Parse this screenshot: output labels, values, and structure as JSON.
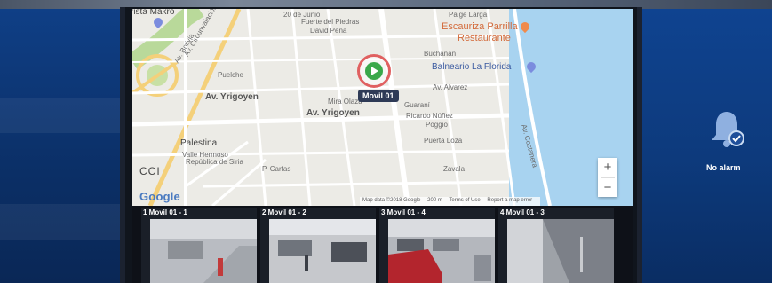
{
  "map": {
    "provider": "Google",
    "attribution": {
      "map_data": "Map data ©2018 Google",
      "scale": "200 m",
      "terms": "Terms of Use",
      "report": "Report a map error"
    },
    "zoom_in": "+",
    "zoom_out": "−",
    "vehicle_label": "Movil 01",
    "pois": {
      "makro": "rista Makro",
      "escaurizza": "Escauriza Parrilla",
      "restaurante": "Restaurante",
      "balneario": "Balneario La Florida"
    },
    "streets": {
      "yrigoyen": "Av. Yrigoyen",
      "yrigoyen2": "Av. Yrigoyen",
      "palestina": "Palestina",
      "ccl": "CCI",
      "buchanan": "Buchanan",
      "rivadavia": "Av. Alvarez",
      "junio": "20 de Junio",
      "puelche": "Puelche",
      "fuerte": "Fuerte del Piedras",
      "david": "David Peña",
      "ricardo": "Ricardo Núñez",
      "poggio": "Poggio",
      "puerta": "Puerta Loza",
      "zavala": "Zavala",
      "carloss": "P. Carfas",
      "bolivia": "Av. Bolivia",
      "calle": "Av. Circunvalación",
      "valle": "Valle Hermoso",
      "republica": "República de Siria",
      "pagelargo": "Paige Larga",
      "guaranay": "Guaraní",
      "costanera": "Av. Costanera",
      "huanca": "Mira Olaza"
    }
  },
  "cameras": [
    {
      "title": "1 Movil 01 - 1"
    },
    {
      "title": "2 Movil 01 - 2"
    },
    {
      "title": "3 Movil 01 - 4"
    },
    {
      "title": "4 Movil 01 - 3"
    }
  ],
  "alarm": {
    "label": "No alarm"
  }
}
